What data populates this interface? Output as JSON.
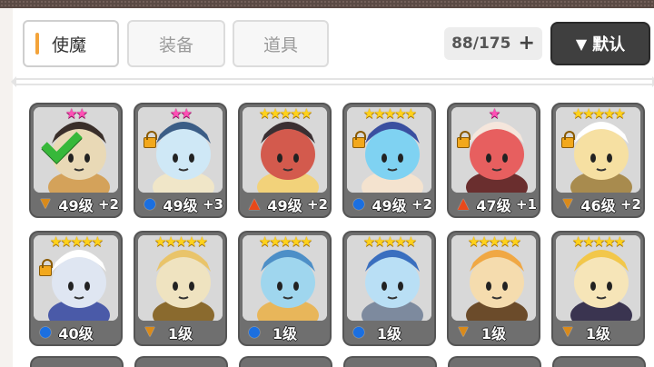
{
  "tabs": [
    {
      "label": "使魔",
      "active": true
    },
    {
      "label": "装备",
      "active": false
    },
    {
      "label": "道具",
      "active": false
    }
  ],
  "capacity": {
    "text": "88/175",
    "plus": "+"
  },
  "sort": {
    "arrow": "▼",
    "label": "默认"
  },
  "cards": [
    {
      "level": "49级",
      "stars": "★★",
      "star_color": "pink",
      "element": "wind",
      "element_icon": "wind-icon",
      "bonus": "+2",
      "locked": false,
      "checked": true,
      "palette": [
        "#e9d9b6",
        "#3a2f2a",
        "#d4a25a"
      ]
    },
    {
      "level": "49级",
      "stars": "★★",
      "star_color": "pink",
      "element": "water",
      "element_icon": "water-icon",
      "bonus": "+3",
      "locked": true,
      "checked": false,
      "palette": [
        "#cfe8f6",
        "#3b5d86",
        "#f0e6c8"
      ]
    },
    {
      "level": "49级",
      "stars": "★★★★★",
      "star_color": "gold",
      "element": "fire",
      "element_icon": "fire-icon",
      "bonus": "+2",
      "locked": false,
      "checked": false,
      "palette": [
        "#d35a4d",
        "#3a2f32",
        "#f2d27a"
      ]
    },
    {
      "level": "49级",
      "stars": "★★★★★",
      "star_color": "gold",
      "element": "water",
      "element_icon": "water-icon",
      "bonus": "+2",
      "locked": true,
      "checked": false,
      "palette": [
        "#7fd2f2",
        "#3a4fa0",
        "#f4e3cf"
      ]
    },
    {
      "level": "47级",
      "stars": "★",
      "star_color": "pink",
      "element": "fire",
      "element_icon": "fire-icon",
      "bonus": "+1",
      "locked": true,
      "checked": false,
      "palette": [
        "#e75f5f",
        "#f5e6dc",
        "#6a2e2e"
      ]
    },
    {
      "level": "46级",
      "stars": "★★★★★",
      "star_color": "gold",
      "element": "wind",
      "element_icon": "wind-icon",
      "bonus": "+2",
      "locked": true,
      "checked": false,
      "palette": [
        "#f6e0a2",
        "#ffffff",
        "#a88b4e"
      ]
    },
    {
      "level": "40级",
      "stars": "★★★★★",
      "star_color": "gold",
      "element": "water",
      "element_icon": "water-icon",
      "bonus": "",
      "locked": true,
      "checked": false,
      "palette": [
        "#dfe6f2",
        "#ffffff",
        "#4a5aa8"
      ]
    },
    {
      "level": "1级",
      "stars": "★★★★★",
      "star_color": "gold",
      "element": "wind",
      "element_icon": "wind-icon",
      "bonus": "",
      "locked": false,
      "checked": false,
      "palette": [
        "#efe3c0",
        "#e9c46a",
        "#8a6a2e"
      ]
    },
    {
      "level": "1级",
      "stars": "★★★★★",
      "star_color": "gold",
      "element": "water",
      "element_icon": "water-icon",
      "bonus": "",
      "locked": false,
      "checked": false,
      "palette": [
        "#9fd6ee",
        "#4d8fc7",
        "#e8b65a"
      ]
    },
    {
      "level": "1级",
      "stars": "★★★★★",
      "star_color": "gold",
      "element": "water",
      "element_icon": "water-icon",
      "bonus": "",
      "locked": false,
      "checked": false,
      "palette": [
        "#b9dff5",
        "#3a6fbf",
        "#7d8a9e"
      ]
    },
    {
      "level": "1级",
      "stars": "★★★★★",
      "star_color": "gold",
      "element": "wind",
      "element_icon": "wind-icon",
      "bonus": "",
      "locked": false,
      "checked": false,
      "palette": [
        "#f5dcae",
        "#f0a844",
        "#6b4b2a"
      ]
    },
    {
      "level": "1级",
      "stars": "★★★★★",
      "star_color": "gold",
      "element": "wind",
      "element_icon": "wind-icon",
      "bonus": "",
      "locked": false,
      "checked": false,
      "palette": [
        "#f6e5b8",
        "#f2c74a",
        "#3a3450"
      ]
    }
  ],
  "colors": {
    "accent": "#f3a33a",
    "card_frame": "#6f6f6f",
    "sort_button": "#3f3f3f"
  }
}
